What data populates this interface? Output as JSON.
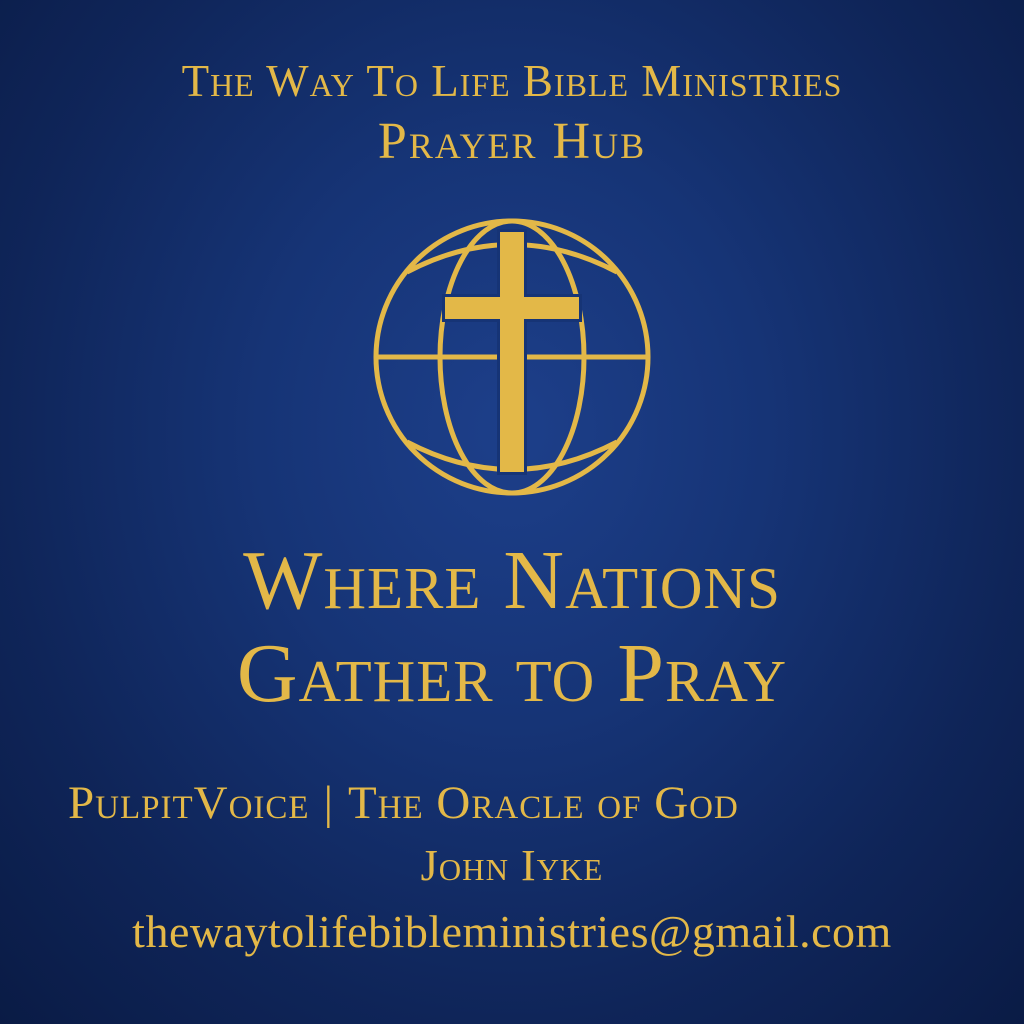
{
  "header": {
    "organization": "The Way To Life Bible Ministries",
    "subtitle": "Prayer Hub"
  },
  "logo": {
    "icon": "globe-with-cross-icon",
    "color": "#e3b848"
  },
  "tagline": {
    "line1": "Where Nations",
    "line2": "Gather to Pray"
  },
  "footer": {
    "brand": "PulpitVoice",
    "separator": "|",
    "brand_subtitle": "The Oracle of God",
    "author": "John Iyke",
    "email": "thewaytolifebibleministries@gmail.com"
  },
  "colors": {
    "background": "#163476",
    "gold": "#e3b848"
  }
}
